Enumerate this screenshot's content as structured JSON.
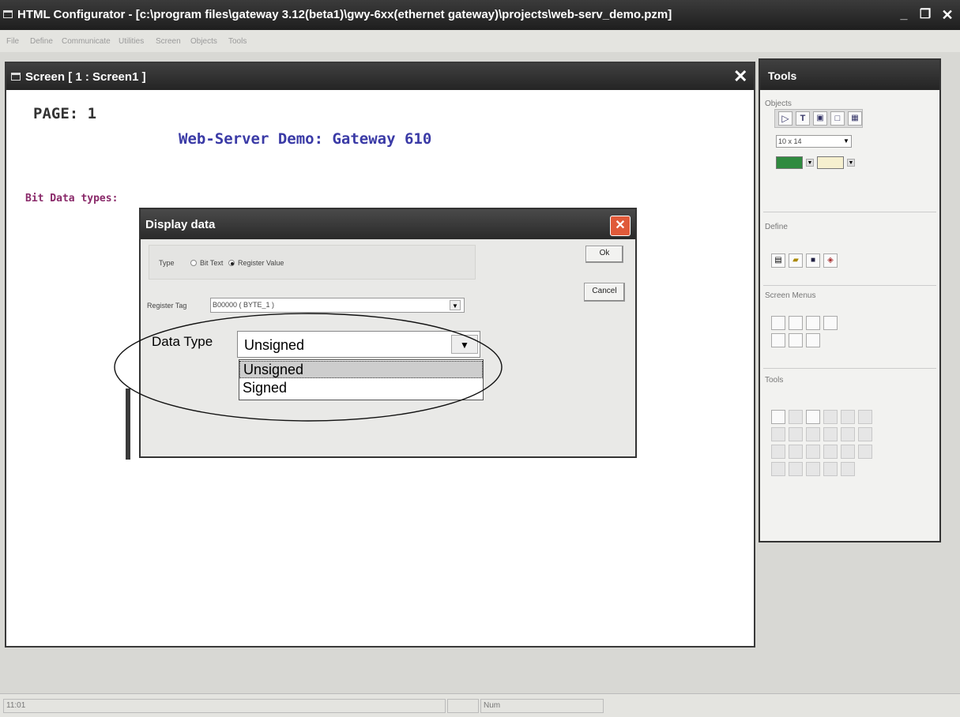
{
  "window": {
    "title": "HTML Configurator - [c:\\program files\\gateway 3.12(beta1)\\gwy-6xx(ethernet gateway)\\projects\\web-serv_demo.pzm]",
    "minimize_glyph": "_",
    "restore_glyph": "❐",
    "close_glyph": "✕"
  },
  "menu": [
    "File",
    "Define",
    "Communicate",
    "Utilities",
    "Screen",
    "Objects",
    "Tools"
  ],
  "screen_window": {
    "title": "Screen [ 1 : Screen1 ]",
    "close_glyph": "✕",
    "page_label": "PAGE: 1",
    "heading": "Web-Server Demo: Gateway 610",
    "bit_label": "Bit Data types:"
  },
  "dialog": {
    "title": "Display data",
    "close_glyph": "✕",
    "type_label": "Type",
    "type_options": [
      "Bit Text",
      "Register Value"
    ],
    "type_selected": "Register Value",
    "register_tag_label": "Register Tag",
    "register_tag_value": "B00000 ( BYTE_1 )",
    "data_type_label": "Data Type",
    "data_type_value": "Unsigned",
    "data_type_options": [
      "Unsigned",
      "Signed"
    ],
    "ok_label": "Ok",
    "cancel_label": "Cancel"
  },
  "tools_panel": {
    "title": "Tools",
    "objects_label": "Objects",
    "font_size": "10 x 14",
    "fg_color": "#2f8a3f",
    "bg_color": "#f6f0cf",
    "define_label": "Define",
    "screen_menus_label": "Screen Menus",
    "tools_label": "Tools"
  },
  "status": {
    "time": "11:01",
    "num": "Num"
  },
  "icons": [
    "window-icon",
    "arrow-icon",
    "text-icon",
    "layer-icon",
    "rectangle-icon",
    "grid-icon",
    "new-icon",
    "open-icon",
    "save-icon",
    "eraser-icon",
    "align-icon"
  ],
  "colors": {
    "heading_blue": "#3a3aa6",
    "bit_label_purple": "#8a2a6a",
    "close_red": "#e05a3a"
  }
}
